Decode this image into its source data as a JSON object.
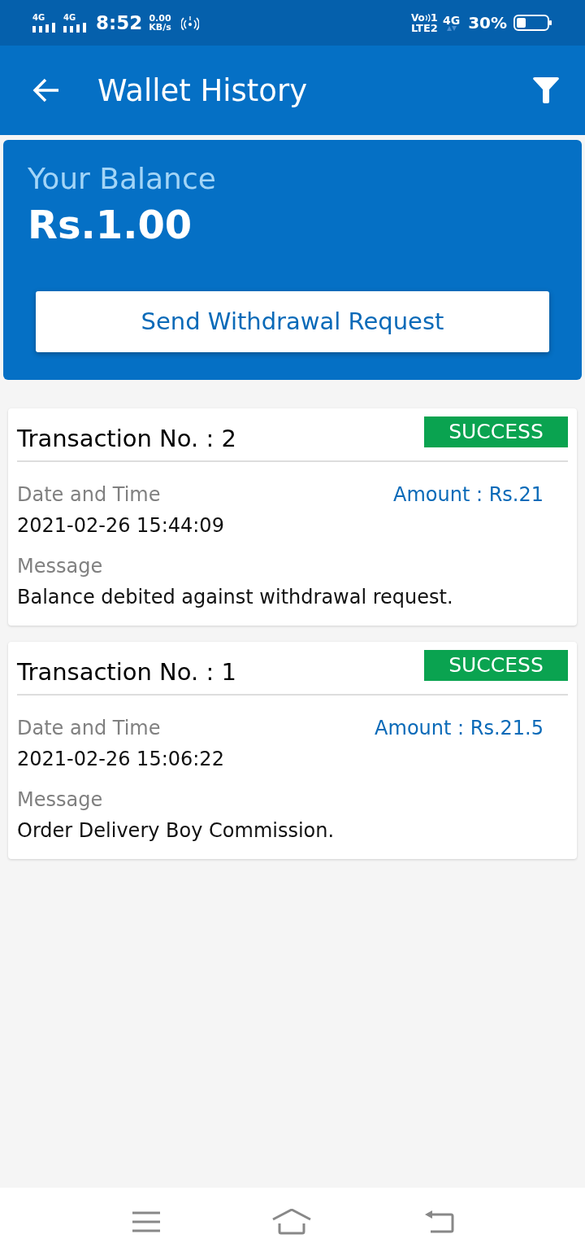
{
  "status_bar": {
    "sims": [
      {
        "network": "4G"
      },
      {
        "network": "4G"
      }
    ],
    "time": "8:52",
    "data_speed": {
      "value": "0.00",
      "unit": "KB/s"
    },
    "volte": {
      "line_1": "Vo",
      "sim": "1",
      "line_2": "LTE2"
    },
    "network": "4G",
    "battery": "30%"
  },
  "header": {
    "title": "Wallet History"
  },
  "balance": {
    "label": "Your Balance",
    "amount": "Rs.1.00",
    "button": "Send Withdrawal Request"
  },
  "transactions": [
    {
      "title": "Transaction No. : 2",
      "status": "SUCCESS",
      "date_label": "Date and Time",
      "date": "2021-02-26 15:44:09",
      "amount": "Amount : Rs.21",
      "message_label": "Message",
      "message": "Balance debited against withdrawal request."
    },
    {
      "title": "Transaction No. : 1",
      "status": "SUCCESS",
      "date_label": "Date and Time",
      "date": "2021-02-26 15:06:22",
      "amount": "Amount : Rs.21.5",
      "message_label": "Message",
      "message": "Order Delivery Boy Commission."
    }
  ]
}
